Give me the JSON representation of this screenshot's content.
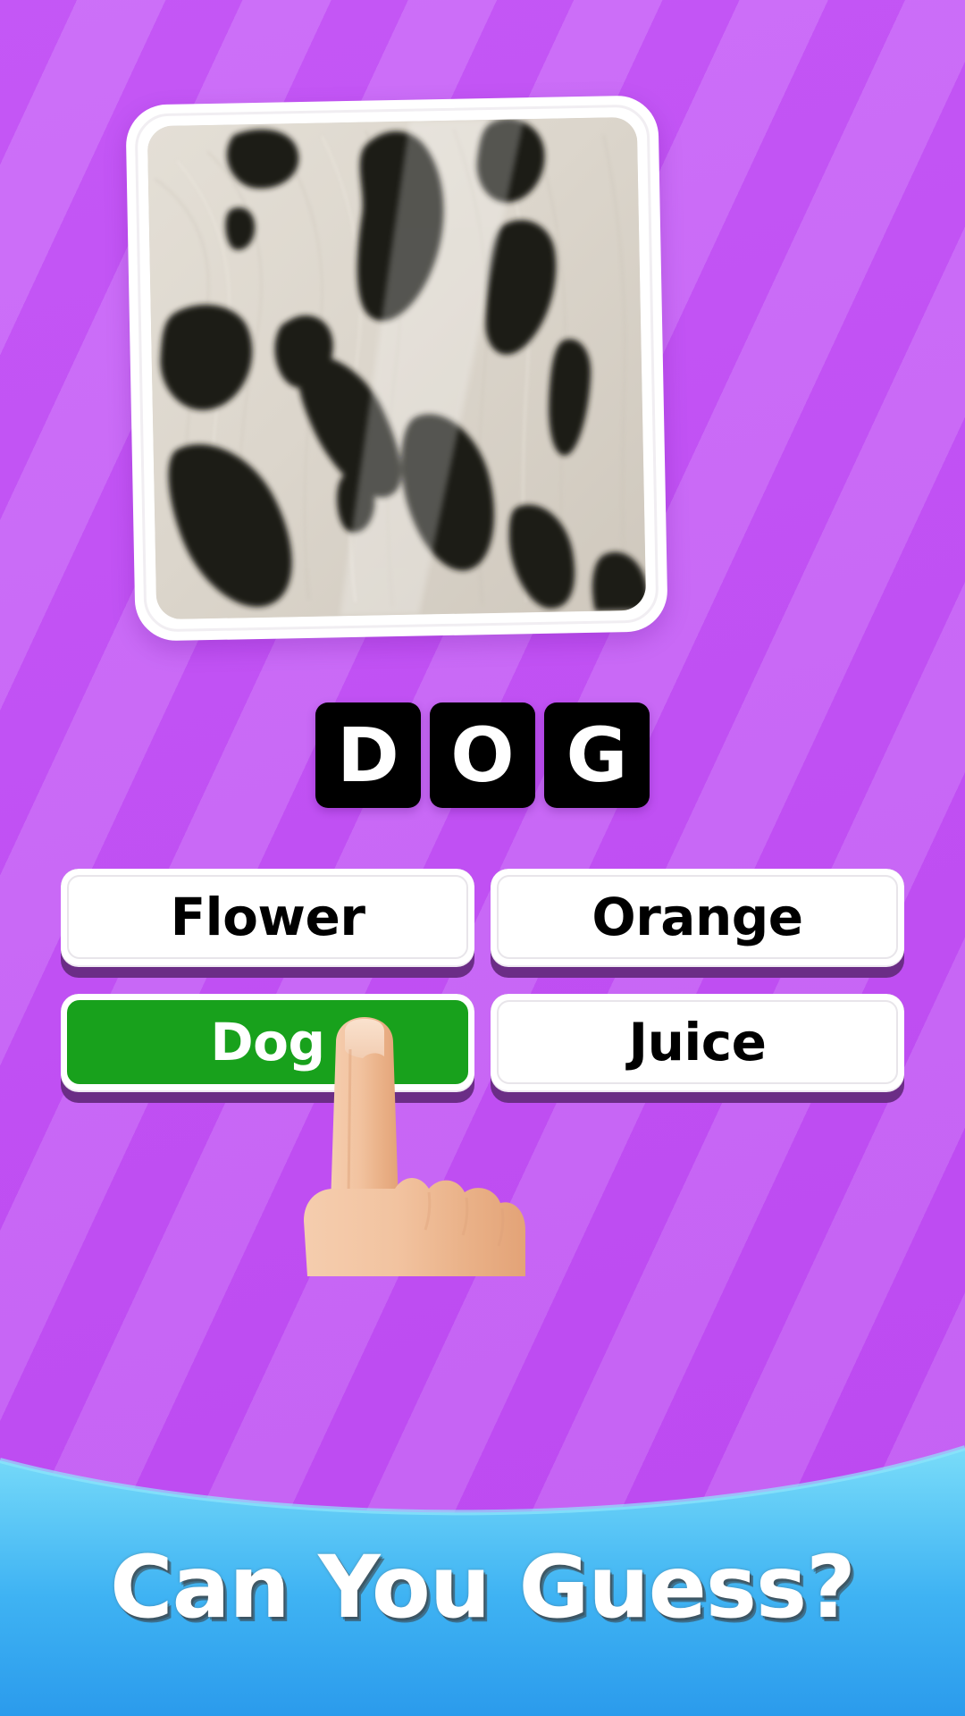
{
  "background": {
    "stripe_color_dark": "#c14ef5",
    "stripe_color_light": "#ca68f8"
  },
  "puzzle_image": {
    "description": "dalmatian-fur-closeup",
    "fur_base_color": "#ddd7cd",
    "spot_color": "#1d1a17"
  },
  "answer_word": {
    "letters": [
      "D",
      "O",
      "G"
    ],
    "tile_bg": "#000000",
    "tile_text_color": "#ffffff"
  },
  "answers": {
    "options": [
      {
        "label": "Flower",
        "state": "default"
      },
      {
        "label": "Orange",
        "state": "default"
      },
      {
        "label": "Dog",
        "state": "correct"
      },
      {
        "label": "Juice",
        "state": "default"
      }
    ],
    "correct_color": "#18a11c",
    "default_color": "#ffffff",
    "shadow_color": "#6b2d86"
  },
  "pointer": {
    "icon": "pointing-hand-icon",
    "skin_color": "#f0bf9a",
    "skin_shadow": "#e0a87f",
    "nail_color": "#f7dcc6"
  },
  "banner": {
    "title": "Can You Guess?",
    "bg_top_color": "#6ed8f7",
    "bg_bottom_color": "#2ea0ee",
    "title_color": "#ffffff"
  }
}
